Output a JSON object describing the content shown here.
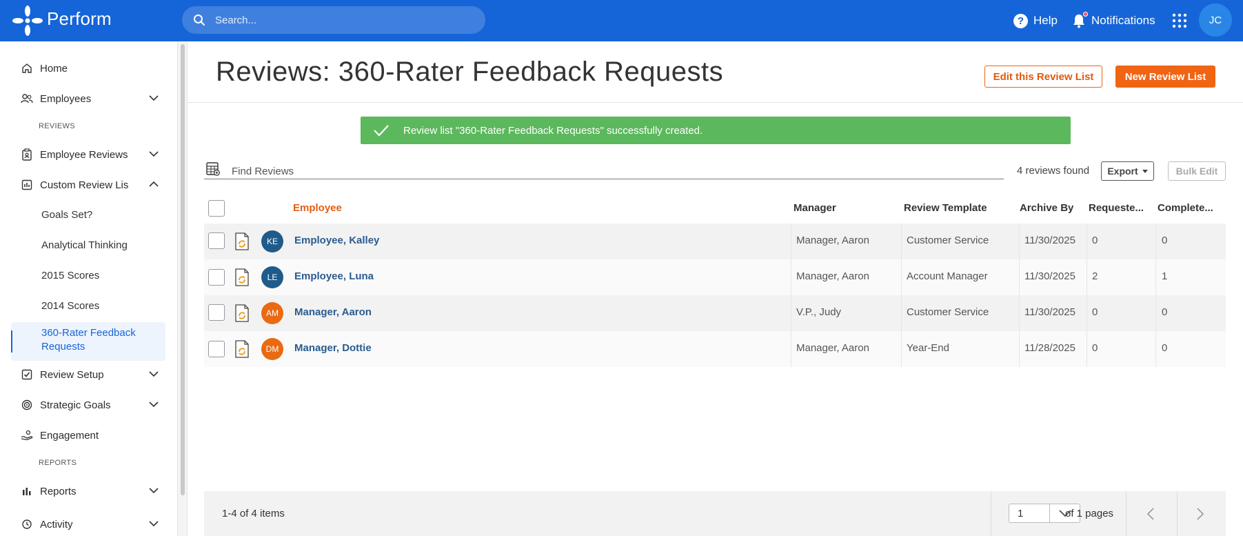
{
  "topbar": {
    "brand": "Perform",
    "search_placeholder": "Search...",
    "help": "Help",
    "notifications": "Notifications",
    "user_initials": "JC",
    "accent": "#1565d8"
  },
  "sidebar": {
    "home": "Home",
    "employees": "Employees",
    "reviews_section": "REVIEWS",
    "employee_reviews": "Employee Reviews",
    "custom_review_lists": "Custom Review Lis",
    "sub_items": [
      "Goals Set?",
      "Analytical Thinking",
      "2015 Scores",
      "2014 Scores"
    ],
    "active_sub_item": "360-Rater Feedback Requests",
    "review_setup": "Review Setup",
    "strategic_goals": "Strategic Goals",
    "engagement": "Engagement",
    "reports_section": "REPORTS",
    "reports": "Reports",
    "activity": "Activity"
  },
  "main": {
    "title": "Reviews: 360-Rater Feedback Requests",
    "edit_button": "Edit this Review List",
    "new_button": "New Review List",
    "toast": "Review list \"360-Rater Feedback Requests\" successfully created.",
    "find_placeholder": "Find Reviews",
    "found": "4 reviews found",
    "export": "Export",
    "bulk_edit": "Bulk Edit"
  },
  "table": {
    "columns": {
      "employee": "Employee",
      "manager": "Manager",
      "template": "Review Template",
      "archive": "Archive By",
      "requested": "Requeste...",
      "completed": "Complete..."
    },
    "rows": [
      {
        "initials": "KE",
        "avatar_color": "#1f5b8a",
        "employee": "Employee, Kalley",
        "manager": "Manager, Aaron",
        "template": "Customer Service",
        "archive": "11/30/2025",
        "requested": "0",
        "completed": "0"
      },
      {
        "initials": "LE",
        "avatar_color": "#1f5b8a",
        "employee": "Employee, Luna",
        "manager": "Manager, Aaron",
        "template": "Account Manager",
        "archive": "11/30/2025",
        "requested": "2",
        "completed": "1"
      },
      {
        "initials": "AM",
        "avatar_color": "#ea6a12",
        "employee": "Manager, Aaron",
        "manager": "V.P., Judy",
        "template": "Customer Service",
        "archive": "11/30/2025",
        "requested": "0",
        "completed": "0"
      },
      {
        "initials": "DM",
        "avatar_color": "#ea6a12",
        "employee": "Manager, Dottie",
        "manager": "Manager, Aaron",
        "template": "Year-End",
        "archive": "11/28/2025",
        "requested": "0",
        "completed": "0"
      }
    ]
  },
  "footer": {
    "items": "1-4 of 4 items",
    "page": "1",
    "of_pages": "of 1 pages"
  }
}
